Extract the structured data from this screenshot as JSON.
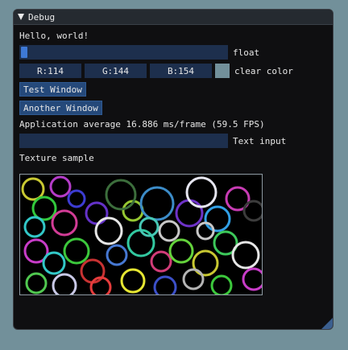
{
  "window": {
    "title": "Debug"
  },
  "hello_text": "Hello, world!",
  "float_slider": {
    "label": "float",
    "value": 0.0
  },
  "clear_color": {
    "r_label": "R:114",
    "g_label": "G:144",
    "b_label": "B:154",
    "swatch_color": "#72909a",
    "label": "clear color"
  },
  "buttons": {
    "test_window": "Test Window",
    "another_window": "Another Window"
  },
  "stats": {
    "text": "Application average 16.886 ms/frame (59.5 FPS)"
  },
  "text_input": {
    "label": "Text input",
    "value": ""
  },
  "texture": {
    "label": "Texture sample"
  },
  "colors": {
    "background": "#72909a",
    "window_bg": "#0f0f11",
    "frame_bg": "#1d2f4d",
    "button_bg": "#25497a",
    "slider_grab": "#3e79d6"
  }
}
